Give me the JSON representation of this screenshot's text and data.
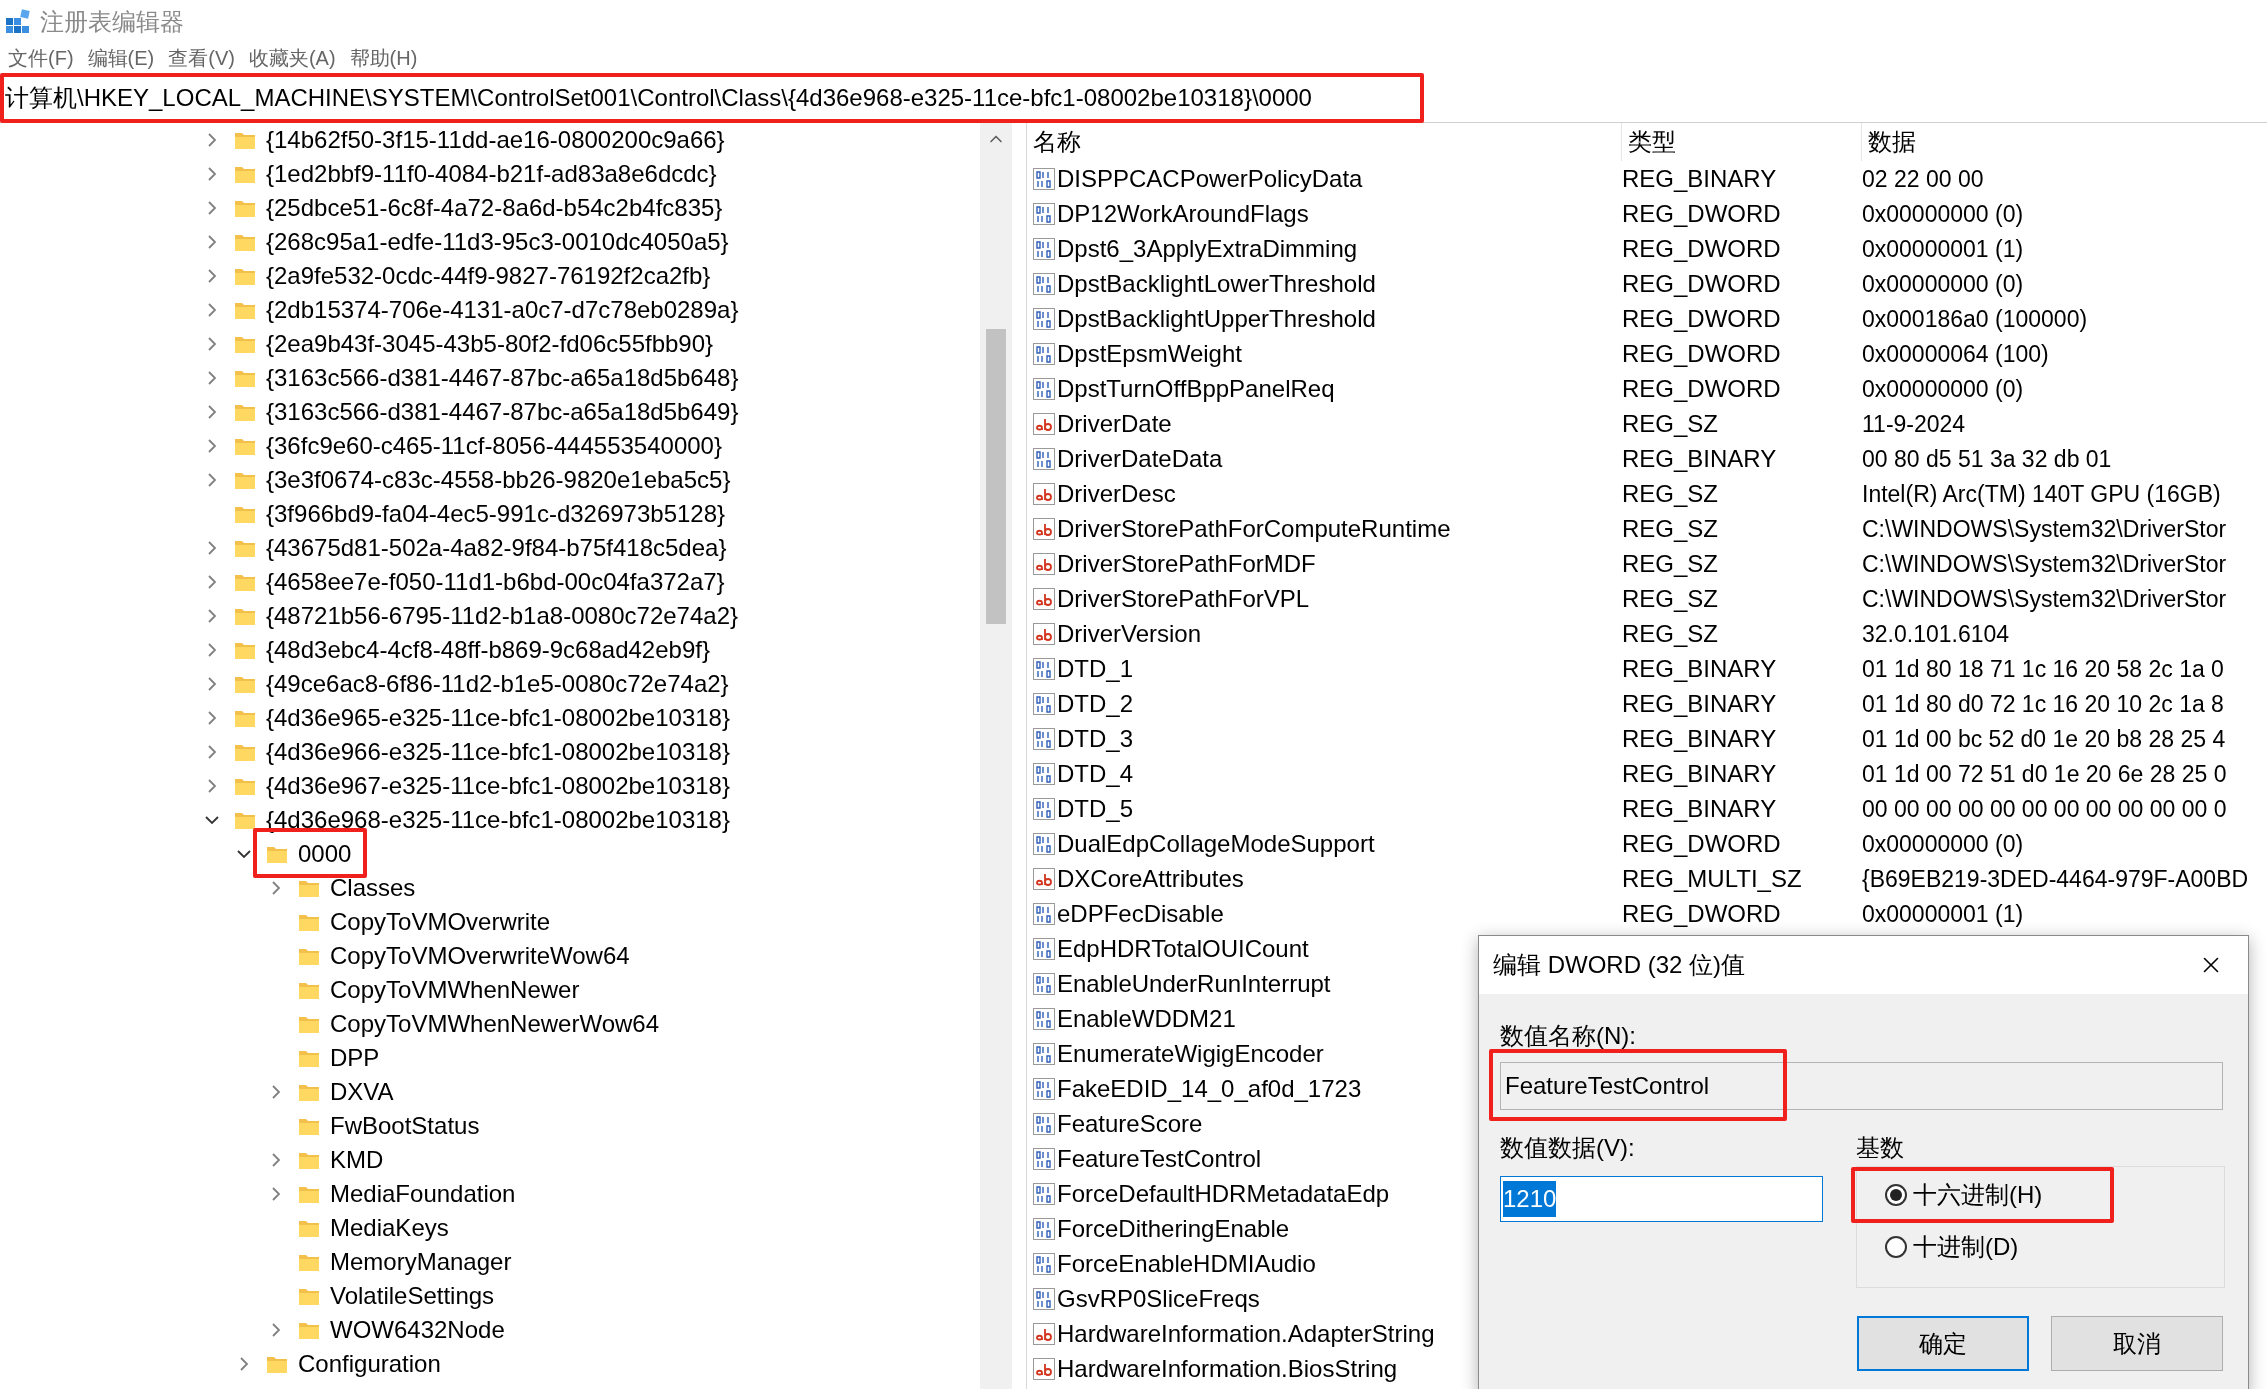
{
  "window": {
    "title": "注册表编辑器"
  },
  "menu": [
    "文件(F)",
    "编辑(E)",
    "查看(V)",
    "收藏夹(A)",
    "帮助(H)"
  ],
  "address": {
    "path": "计算机\\HKEY_LOCAL_MACHINE\\SYSTEM\\ControlSet001\\Control\\Class\\{4d36e968-e325-11ce-bfc1-08002be10318}\\0000",
    "highlighted": true
  },
  "tree": {
    "items": [
      {
        "label": "{14b62f50-3f15-11dd-ae16-0800200c9a66}",
        "expandable": true,
        "expanded": false,
        "highlighted": false
      },
      {
        "label": "{1ed2bbf9-11f0-4084-b21f-ad83a8e6dcdc}",
        "expandable": true,
        "expanded": false,
        "highlighted": false
      },
      {
        "label": "{25dbce51-6c8f-4a72-8a6d-b54c2b4fc835}",
        "expandable": true,
        "expanded": false,
        "highlighted": false
      },
      {
        "label": "{268c95a1-edfe-11d3-95c3-0010dc4050a5}",
        "expandable": true,
        "expanded": false,
        "highlighted": false
      },
      {
        "label": "{2a9fe532-0cdc-44f9-9827-76192f2ca2fb}",
        "expandable": true,
        "expanded": false,
        "highlighted": false
      },
      {
        "label": "{2db15374-706e-4131-a0c7-d7c78eb0289a}",
        "expandable": true,
        "expanded": false,
        "highlighted": false
      },
      {
        "label": "{2ea9b43f-3045-43b5-80f2-fd06c55fbb90}",
        "expandable": true,
        "expanded": false,
        "highlighted": false
      },
      {
        "label": "{3163c566-d381-4467-87bc-a65a18d5b648}",
        "expandable": true,
        "expanded": false,
        "highlighted": false
      },
      {
        "label": "{3163c566-d381-4467-87bc-a65a18d5b649}",
        "expandable": true,
        "expanded": false,
        "highlighted": false
      },
      {
        "label": "{36fc9e60-c465-11cf-8056-444553540000}",
        "expandable": true,
        "expanded": false,
        "highlighted": false
      },
      {
        "label": "{3e3f0674-c83c-4558-bb26-9820e1eba5c5}",
        "expandable": true,
        "expanded": false,
        "highlighted": false
      },
      {
        "label": "{3f966bd9-fa04-4ec5-991c-d326973b5128}",
        "expandable": false,
        "highlighted": false
      },
      {
        "label": "{43675d81-502a-4a82-9f84-b75f418c5dea}",
        "expandable": true,
        "expanded": false,
        "highlighted": false
      },
      {
        "label": "{4658ee7e-f050-11d1-b6bd-00c04fa372a7}",
        "expandable": true,
        "expanded": false,
        "highlighted": false
      },
      {
        "label": "{48721b56-6795-11d2-b1a8-0080c72e74a2}",
        "expandable": true,
        "expanded": false,
        "highlighted": false
      },
      {
        "label": "{48d3ebc4-4cf8-48ff-b869-9c68ad42eb9f}",
        "expandable": true,
        "expanded": false,
        "highlighted": false
      },
      {
        "label": "{49ce6ac8-6f86-11d2-b1e5-0080c72e74a2}",
        "expandable": true,
        "expanded": false,
        "highlighted": false
      },
      {
        "label": "{4d36e965-e325-11ce-bfc1-08002be10318}",
        "expandable": true,
        "expanded": false,
        "highlighted": false
      },
      {
        "label": "{4d36e966-e325-11ce-bfc1-08002be10318}",
        "expandable": true,
        "expanded": false,
        "highlighted": false
      },
      {
        "label": "{4d36e967-e325-11ce-bfc1-08002be10318}",
        "expandable": true,
        "expanded": false,
        "highlighted": false
      },
      {
        "label": "{4d36e968-e325-11ce-bfc1-08002be10318}",
        "expandable": true,
        "expanded": true,
        "highlighted": false,
        "children": [
          {
            "label": "0000",
            "expandable": true,
            "expanded": true,
            "highlighted": true,
            "children": [
              {
                "label": "Classes",
                "expandable": true,
                "expanded": false,
                "highlighted": false
              },
              {
                "label": "CopyToVMOverwrite",
                "expandable": false,
                "highlighted": false
              },
              {
                "label": "CopyToVMOverwriteWow64",
                "expandable": false,
                "highlighted": false
              },
              {
                "label": "CopyToVMWhenNewer",
                "expandable": false,
                "highlighted": false
              },
              {
                "label": "CopyToVMWhenNewerWow64",
                "expandable": false,
                "highlighted": false
              },
              {
                "label": "DPP",
                "expandable": false,
                "highlighted": false
              },
              {
                "label": "DXVA",
                "expandable": true,
                "expanded": false,
                "highlighted": false
              },
              {
                "label": "FwBootStatus",
                "expandable": false,
                "highlighted": false
              },
              {
                "label": "KMD",
                "expandable": true,
                "expanded": false,
                "highlighted": false
              },
              {
                "label": "MediaFoundation",
                "expandable": true,
                "expanded": false,
                "highlighted": false
              },
              {
                "label": "MediaKeys",
                "expandable": false,
                "highlighted": false
              },
              {
                "label": "MemoryManager",
                "expandable": false,
                "highlighted": false
              },
              {
                "label": "VolatileSettings",
                "expandable": false,
                "highlighted": false
              },
              {
                "label": "WOW6432Node",
                "expandable": true,
                "expanded": false,
                "highlighted": false
              }
            ]
          },
          {
            "label": "Configuration",
            "expandable": true,
            "expanded": false,
            "highlighted": false
          }
        ]
      }
    ]
  },
  "values": {
    "columns": [
      "名称",
      "类型",
      "数据"
    ],
    "rows": [
      {
        "kind": "binary",
        "name": "DISPPCACPowerPolicyData",
        "type": "REG_BINARY",
        "data": "02 22 00 00"
      },
      {
        "kind": "binary",
        "name": "DP12WorkAroundFlags",
        "type": "REG_DWORD",
        "data": "0x00000000 (0)"
      },
      {
        "kind": "binary",
        "name": "Dpst6_3ApplyExtraDimming",
        "type": "REG_DWORD",
        "data": "0x00000001 (1)"
      },
      {
        "kind": "binary",
        "name": "DpstBacklightLowerThreshold",
        "type": "REG_DWORD",
        "data": "0x00000000 (0)"
      },
      {
        "kind": "binary",
        "name": "DpstBacklightUpperThreshold",
        "type": "REG_DWORD",
        "data": "0x000186a0 (100000)"
      },
      {
        "kind": "binary",
        "name": "DpstEpsmWeight",
        "type": "REG_DWORD",
        "data": "0x00000064 (100)"
      },
      {
        "kind": "binary",
        "name": "DpstTurnOffBppPanelReq",
        "type": "REG_DWORD",
        "data": "0x00000000 (0)"
      },
      {
        "kind": "string",
        "name": "DriverDate",
        "type": "REG_SZ",
        "data": "11-9-2024"
      },
      {
        "kind": "binary",
        "name": "DriverDateData",
        "type": "REG_BINARY",
        "data": "00 80 d5 51 3a 32 db 01"
      },
      {
        "kind": "string",
        "name": "DriverDesc",
        "type": "REG_SZ",
        "data": "Intel(R) Arc(TM) 140T GPU (16GB)"
      },
      {
        "kind": "string",
        "name": "DriverStorePathForComputeRuntime",
        "type": "REG_SZ",
        "data": "C:\\WINDOWS\\System32\\DriverStor"
      },
      {
        "kind": "string",
        "name": "DriverStorePathForMDF",
        "type": "REG_SZ",
        "data": "C:\\WINDOWS\\System32\\DriverStor"
      },
      {
        "kind": "string",
        "name": "DriverStorePathForVPL",
        "type": "REG_SZ",
        "data": "C:\\WINDOWS\\System32\\DriverStor"
      },
      {
        "kind": "string",
        "name": "DriverVersion",
        "type": "REG_SZ",
        "data": "32.0.101.6104"
      },
      {
        "kind": "binary",
        "name": "DTD_1",
        "type": "REG_BINARY",
        "data": "01 1d 80 18 71 1c 16 20 58 2c 1a 0"
      },
      {
        "kind": "binary",
        "name": "DTD_2",
        "type": "REG_BINARY",
        "data": "01 1d 80 d0 72 1c 16 20 10 2c 1a 8"
      },
      {
        "kind": "binary",
        "name": "DTD_3",
        "type": "REG_BINARY",
        "data": "01 1d 00 bc 52 d0 1e 20 b8 28 25 4"
      },
      {
        "kind": "binary",
        "name": "DTD_4",
        "type": "REG_BINARY",
        "data": "01 1d 00 72 51 d0 1e 20 6e 28 25 0"
      },
      {
        "kind": "binary",
        "name": "DTD_5",
        "type": "REG_BINARY",
        "data": "00 00 00 00 00 00 00 00 00 00 00 0"
      },
      {
        "kind": "binary",
        "name": "DualEdpCollageModeSupport",
        "type": "REG_DWORD",
        "data": "0x00000000 (0)"
      },
      {
        "kind": "string",
        "name": "DXCoreAttributes",
        "type": "REG_MULTI_SZ",
        "data": "{B69EB219-3DED-4464-979F-A00BD"
      },
      {
        "kind": "binary",
        "name": "eDPFecDisable",
        "type": "REG_DWORD",
        "data": "0x00000001 (1)"
      },
      {
        "kind": "binary",
        "name": "EdpHDRTotalOUICount"
      },
      {
        "kind": "binary",
        "name": "EnableUnderRunInterrupt"
      },
      {
        "kind": "binary",
        "name": "EnableWDDM21"
      },
      {
        "kind": "binary",
        "name": "EnumerateWigigEncoder"
      },
      {
        "kind": "binary",
        "name": "FakeEDID_14_0_af0d_1723"
      },
      {
        "kind": "binary",
        "name": "FeatureScore"
      },
      {
        "kind": "binary",
        "name": "FeatureTestControl"
      },
      {
        "kind": "binary",
        "name": "ForceDefaultHDRMetadataEdp"
      },
      {
        "kind": "binary",
        "name": "ForceDitheringEnable"
      },
      {
        "kind": "binary",
        "name": "ForceEnableHDMIAudio"
      },
      {
        "kind": "binary",
        "name": "GsvRP0SliceFreqs"
      },
      {
        "kind": "string",
        "name": "HardwareInformation.AdapterString"
      },
      {
        "kind": "string",
        "name": "HardwareInformation.BiosString"
      }
    ]
  },
  "dialog": {
    "title": "编辑 DWORD (32 位)值",
    "name_label": "数值名称(N):",
    "name_value": "FeatureTestControl",
    "name_highlighted": true,
    "data_label": "数值数据(V):",
    "data_value": "1210",
    "data_selected": true,
    "base": {
      "label": "基数",
      "options": [
        {
          "label": "十六进制(H)",
          "selected": true,
          "highlighted": true
        },
        {
          "label": "十进制(D)",
          "selected": false,
          "highlighted": false
        }
      ]
    },
    "buttons": [
      {
        "label": "确定",
        "default": true
      },
      {
        "label": "取消",
        "default": false
      }
    ]
  }
}
